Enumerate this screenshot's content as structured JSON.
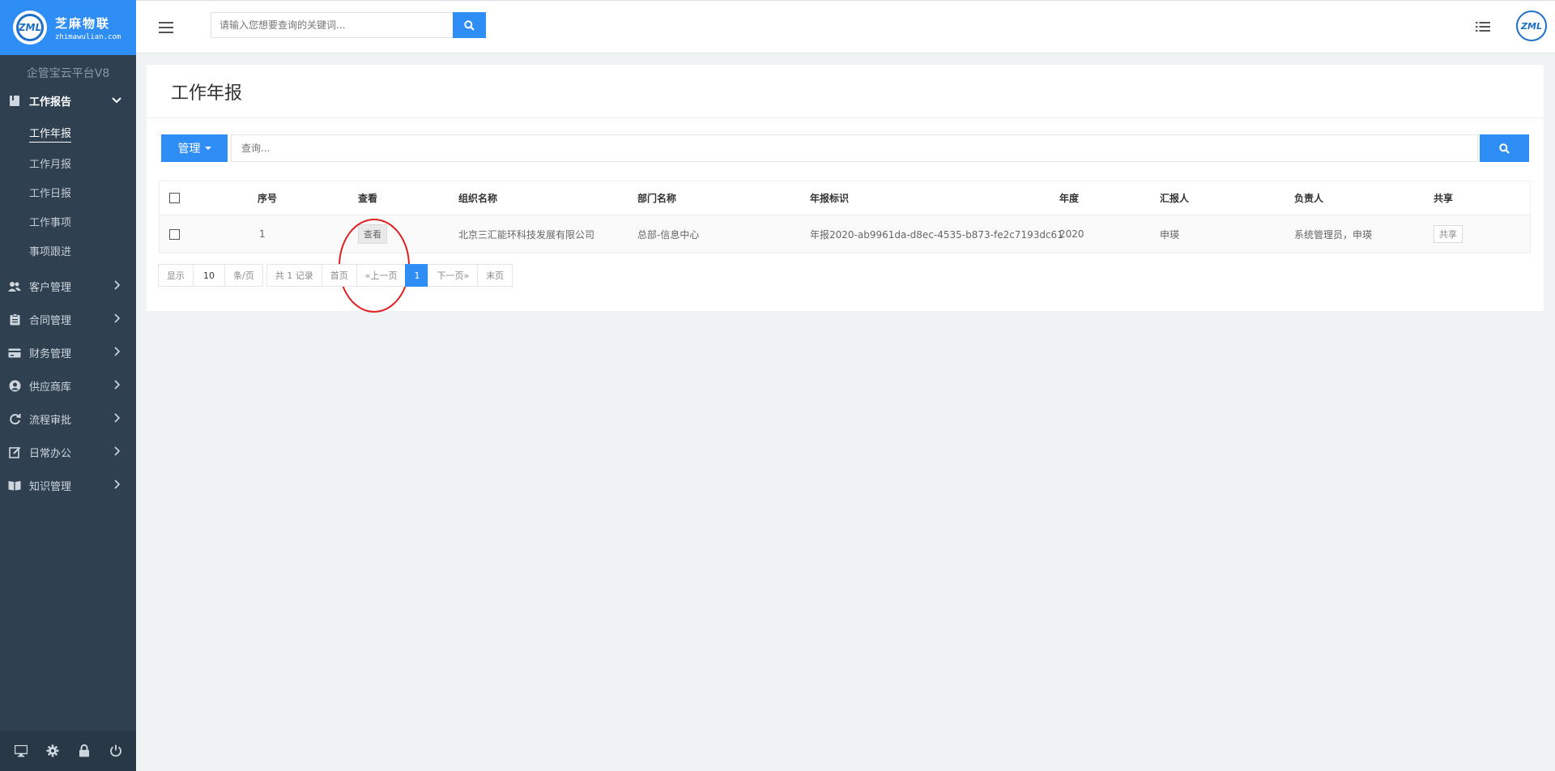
{
  "brand": {
    "name_cn": "芝麻物联",
    "name_en": "zhimawulian.com",
    "logo_letters": "ZML"
  },
  "platform_title": "企管宝云平台V8",
  "sidebar": {
    "sections": [
      {
        "label": "工作报告",
        "icon": "book-icon",
        "expanded": true
      },
      {
        "label": "客户管理",
        "icon": "users-icon"
      },
      {
        "label": "合同管理",
        "icon": "clipboard-icon"
      },
      {
        "label": "财务管理",
        "icon": "credit-card-icon"
      },
      {
        "label": "供应商库",
        "icon": "user-circle-icon"
      },
      {
        "label": "流程审批",
        "icon": "refresh-icon"
      },
      {
        "label": "日常办公",
        "icon": "edit-icon"
      },
      {
        "label": "知识管理",
        "icon": "open-book-icon"
      }
    ],
    "subitems": [
      "工作年报",
      "工作月报",
      "工作日报",
      "工作事项",
      "事项跟进"
    ],
    "active_subitem": "工作年报",
    "footer_icons": [
      "monitor-icon",
      "gear-icon",
      "lock-icon",
      "power-icon"
    ]
  },
  "topbar": {
    "search_placeholder": "请输入您想要查询的关键词...",
    "search_icon": "search-icon",
    "list_icon": "list-icon"
  },
  "page": {
    "title": "工作年报",
    "manage_label": "管理",
    "query_placeholder": "查询...",
    "table": {
      "headers": [
        "序号",
        "查看",
        "组织名称",
        "部门名称",
        "年报标识",
        "年度",
        "汇报人",
        "负责人",
        "共享"
      ],
      "rows": [
        {
          "index": "1",
          "view_label": "查看",
          "org": "北京三汇能环科技发展有限公司",
          "dept": "总部-信息中心",
          "report_id": "年报2020-ab9961da-d8ec-4535-b873-fe2c7193dc61",
          "year": "2020",
          "reporter": "申瑛",
          "owner": "系统管理员，申瑛",
          "share_label": "共享"
        }
      ]
    },
    "pager": {
      "show": "显示",
      "page_size": "10",
      "per_page": "条/页",
      "total": "共 1 记录",
      "first": "首页",
      "prev": "«上一页",
      "current": "1",
      "next": "下一页»",
      "last": "末页"
    }
  },
  "colors": {
    "sidebar": "#2f4050",
    "accent": "#2f8ef5",
    "annotation": "#e02020"
  }
}
